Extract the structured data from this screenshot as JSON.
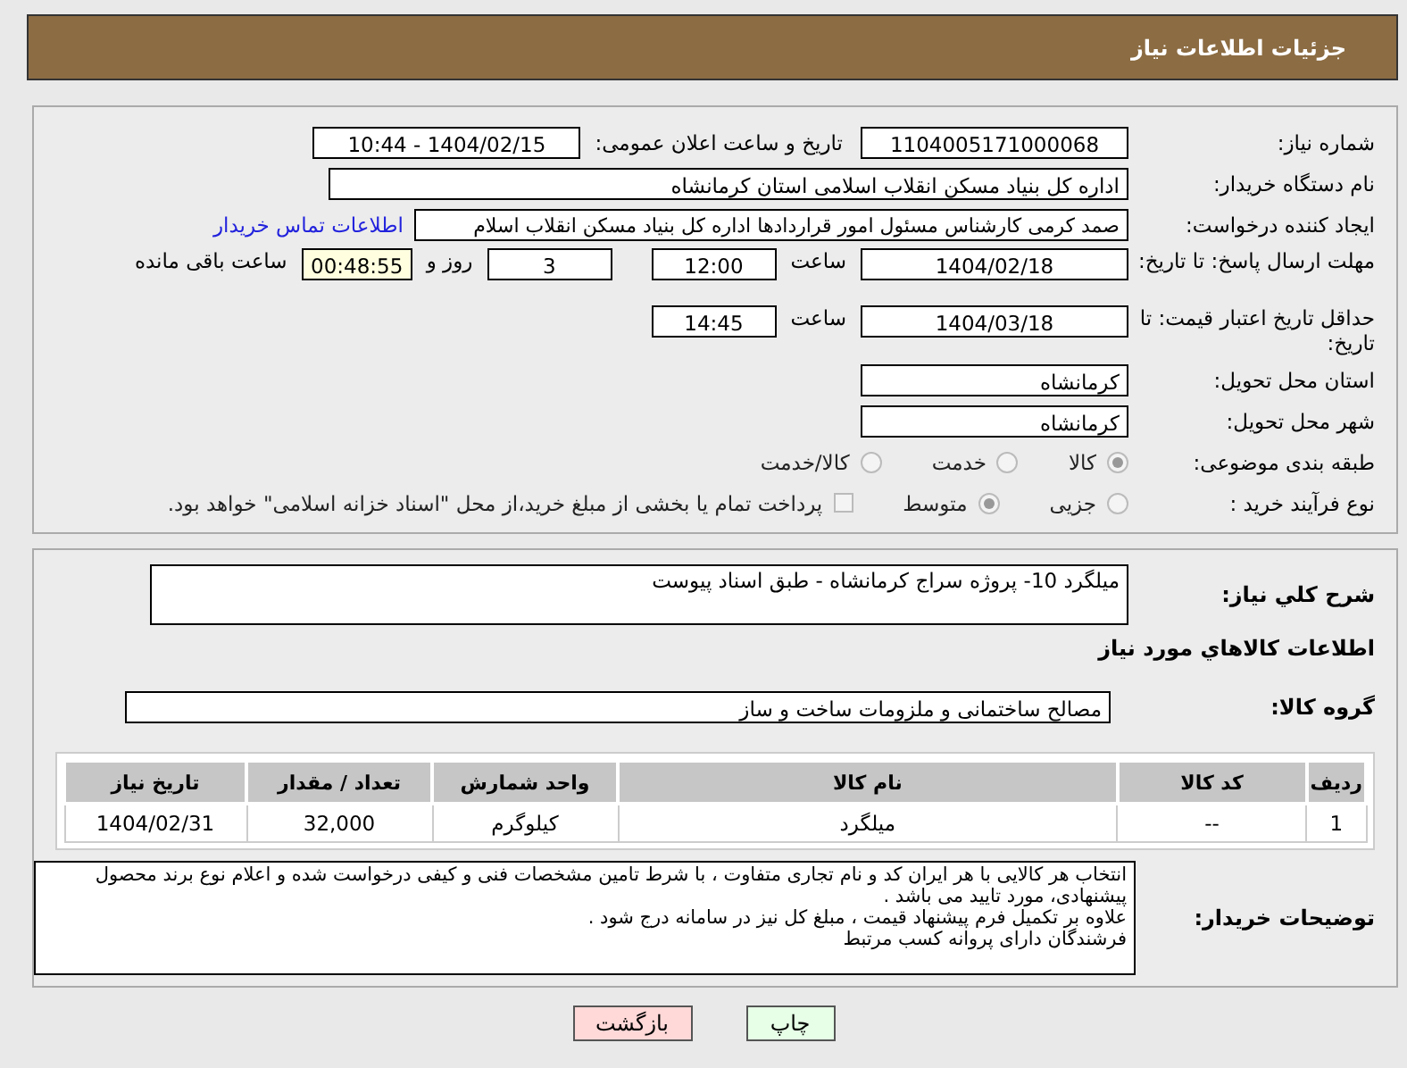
{
  "header": {
    "title": "جزئیات اطلاعات نیاز"
  },
  "need_number": {
    "label": "شماره نیاز:",
    "value": "1104005171000068"
  },
  "announce": {
    "label": "تاریخ و ساعت اعلان عمومی:",
    "value": "1404/02/15 - 10:44"
  },
  "buyer_org": {
    "label": "نام دستگاه خریدار:",
    "value": "اداره کل بنیاد مسکن انقلاب اسلامی استان کرمانشاه"
  },
  "creator": {
    "label": "ایجاد کننده درخواست:",
    "value": "صمد کرمی کارشناس مسئول امور قراردادها اداره کل بنیاد مسکن انقلاب اسلام",
    "link": "اطلاعات تماس خریدار"
  },
  "deadline": {
    "label": "مهلت ارسال پاسخ: تا تاریخ:",
    "date": "1404/02/18",
    "time_label": "ساعت",
    "time": "12:00",
    "days": "3",
    "days_label": "روز و",
    "remaining": "00:48:55",
    "remaining_label": "ساعت باقی مانده"
  },
  "validity": {
    "label": "حداقل تاریخ اعتبار قیمت: تا تاریخ:",
    "date": "1404/03/18",
    "time_label": "ساعت",
    "time": "14:45"
  },
  "province": {
    "label": "استان محل تحویل:",
    "value": "کرمانشاه"
  },
  "city": {
    "label": "شهر محل تحویل:",
    "value": "کرمانشاه"
  },
  "category": {
    "label": "طبقه بندی موضوعی:",
    "options": [
      {
        "label": "کالا",
        "selected": true
      },
      {
        "label": "خدمت",
        "selected": false
      },
      {
        "label": "کالا/خدمت",
        "selected": false
      }
    ]
  },
  "purchase_type": {
    "label": "نوع فرآیند خرید :",
    "options": [
      {
        "label": "جزیی",
        "selected": false
      },
      {
        "label": "متوسط",
        "selected": true
      }
    ],
    "payment": {
      "checked": false,
      "text": "پرداخت تمام یا بخشی از مبلغ خرید،از محل \"اسناد خزانه اسلامی\" خواهد بود."
    }
  },
  "description": {
    "label": "شرح کلي نیاز:",
    "value": "میلگرد 10- پروژه سراج کرمانشاه - طبق اسناد پیوست"
  },
  "goods_title": "اطلاعات کالاهاي مورد نیاز",
  "goods_group": {
    "label": "گروه کالا:",
    "value": "مصالح ساختمانی و ملزومات ساخت و ساز"
  },
  "table": {
    "columns": [
      "ردیف",
      "کد کالا",
      "نام کالا",
      "واحد شمارش",
      "تعداد / مقدار",
      "تاریخ نیاز"
    ],
    "rows": [
      [
        "1",
        "--",
        "میلگرد",
        "کیلوگرم",
        "32,000",
        "1404/02/31"
      ]
    ]
  },
  "buyer_notes": {
    "label": "توضیحات خریدار:",
    "lines": [
      "انتخاب هر کالایی با هر ایران کد و نام تجاری متفاوت ، با شرط تامین مشخصات فنی و کیفی درخواست شده و اعلام نوع برند محصول پیشنهادی، مورد تایید می باشد .",
      "علاوه بر تکمیل فرم پیشنهاد قیمت ، مبلغ کل نیز در سامانه درج شود .",
      "فرشندگان دارای پروانه کسب مرتبط"
    ]
  },
  "buttons": [
    {
      "label": "چاپ",
      "kind": "print"
    },
    {
      "label": "بازگشت",
      "kind": "back"
    }
  ]
}
